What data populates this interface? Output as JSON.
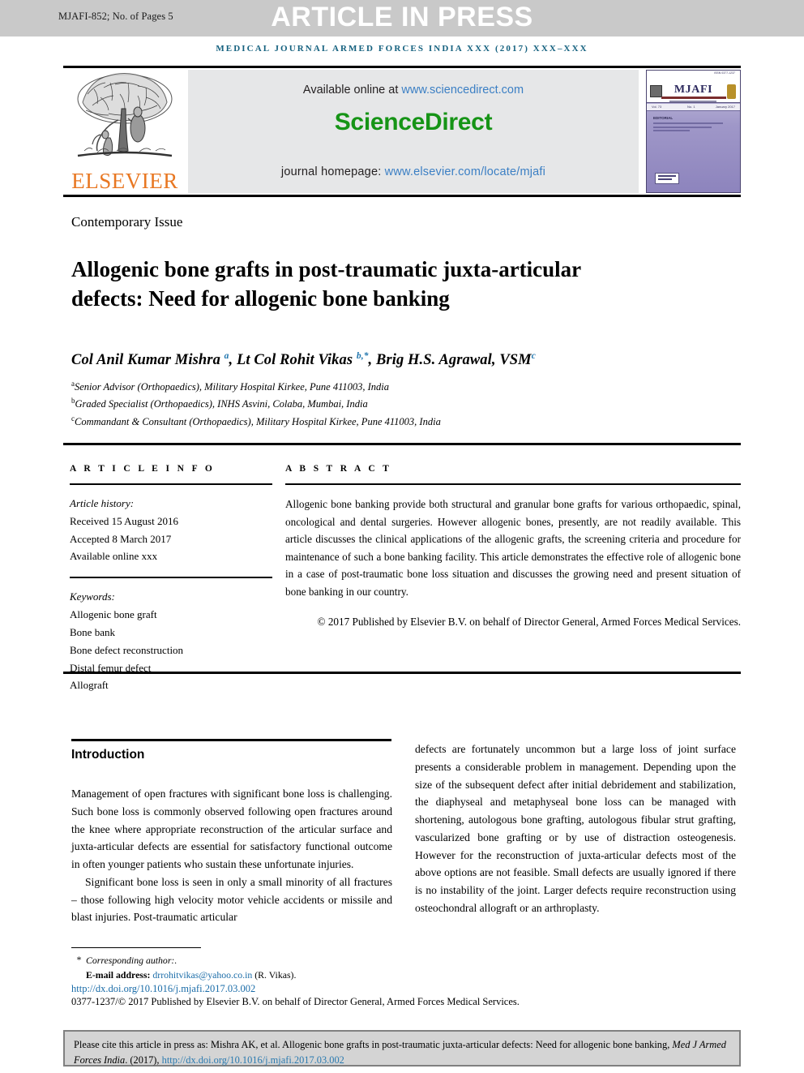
{
  "banner": {
    "article_id": "MJAFI-852; No. of Pages 5",
    "status": "ARTICLE IN PRESS"
  },
  "running_head": "MEDICAL JOURNAL ARMED FORCES INDIA XXX (2017) XXX–XXX",
  "masthead": {
    "publisher": "ELSEVIER",
    "available_prefix": "Available online at ",
    "available_link": "www.sciencedirect.com",
    "sciencedirect_logo": "ScienceDirect",
    "homepage_prefix": "journal homepage: ",
    "homepage_link": "www.elsevier.com/locate/mjafi",
    "cover": {
      "title": "MJAFI",
      "subtitle": "MEDICAL JOURNAL ARMED FORCES INDIA",
      "vol_label": "Vol. 73",
      "issue_label": "No. 1",
      "year_label": "January 2017",
      "issn": "ISSN 0377-1237",
      "article_heading": "EDITORIAL",
      "colors": {
        "cover_top": "#c9c4e0",
        "cover_bottom": "#8d84bd"
      }
    }
  },
  "article": {
    "section_label": "Contemporary Issue",
    "title": "Allogenic bone grafts in post-traumatic juxta-articular defects: Need for allogenic bone banking",
    "authors_html": "Col Anil Kumar Mishra <sup>a</sup>, Lt Col Rohit Vikas <sup>b,</sup><sup>*</sup>, Brig H.S. Agrawal, VSM<sup>c</sup>",
    "affiliations": [
      {
        "marker": "a",
        "text": "Senior Advisor (Orthopaedics), Military Hospital Kirkee, Pune 411003, India"
      },
      {
        "marker": "b",
        "text": "Graded Specialist (Orthopaedics), INHS Asvini, Colaba, Mumbai, India"
      },
      {
        "marker": "c",
        "text": "Commandant & Consultant (Orthopaedics), Military Hospital Kirkee, Pune 411003, India"
      }
    ]
  },
  "article_info": {
    "label": "A R T I C L E   I N F O",
    "history_label": "Article history:",
    "received": "Received 15 August 2016",
    "accepted": "Accepted 8 March 2017",
    "available": "Available online xxx",
    "keywords_label": "Keywords:",
    "keywords": [
      "Allogenic bone graft",
      "Bone bank",
      "Bone defect reconstruction",
      "Distal femur defect",
      "Allograft"
    ]
  },
  "abstract": {
    "label": "A B S T R A C T",
    "text": "Allogenic bone banking provide both structural and granular bone grafts for various orthopaedic, spinal, oncological and dental surgeries. However allogenic bones, presently, are not readily available. This article discusses the clinical applications of the allogenic grafts, the screening criteria and procedure for maintenance of such a bone banking facility. This article demonstrates the effective role of allogenic bone in a case of post-traumatic bone loss situation and discusses the growing need and present situation of bone banking in our country.",
    "copyright": "© 2017 Published by Elsevier B.V. on behalf of Director General, Armed Forces Medical Services."
  },
  "body": {
    "intro_heading": "Introduction",
    "left_paragraphs": [
      "Management of open fractures with significant bone loss is challenging. Such bone loss is commonly observed following open fractures around the knee where appropriate reconstruction of the articular surface and juxta-articular defects are essential for satisfactory functional outcome in often younger patients who sustain these unfortunate injuries.",
      "Significant bone loss is seen in only a small minority of all fractures – those following high velocity motor vehicle accidents or missile and blast injuries. Post-traumatic articular"
    ],
    "right_paragraphs": [
      "defects are fortunately uncommon but a large loss of joint surface presents a considerable problem in management. Depending upon the size of the subsequent defect after initial debridement and stabilization, the diaphyseal and metaphyseal bone loss can be managed with shortening, autologous bone grafting, autologous fibular strut grafting, vascularized bone grafting or by use of distraction osteogenesis. However for the reconstruction of juxta-articular defects most of the above options are not feasible. Small defects are usually ignored if there is no instability of the joint. Larger defects require reconstruction using osteochondral allograft or an arthroplasty."
    ]
  },
  "footer": {
    "corresponding_author": "Corresponding author:.",
    "email_label": "E-mail address:",
    "email": "drrohitvikas@yahoo.co.in",
    "email_suffix": "(R. Vikas).",
    "doi": "http://dx.doi.org/10.1016/j.mjafi.2017.03.002",
    "issn_line": "0377-1237/© 2017 Published by Elsevier B.V. on behalf of Director General, Armed Forces Medical Services."
  },
  "cite_box": {
    "prefix": "Please cite this article in press as: Mishra AK, et al. Allogenic bone grafts in post-traumatic juxta-articular defects: Need for allogenic bone banking, ",
    "journal": "Med J Armed Forces India",
    "middle": ". (2017), ",
    "doi": "http://dx.doi.org/10.1016/j.mjafi.2017.03.002"
  },
  "colors": {
    "banner_gray": "#c9c9c9",
    "running_head_blue": "#15617f",
    "sciencedirect_green": "#169416",
    "elsevier_orange": "#e87722",
    "link_blue": "#3b7fc4",
    "superscript_blue": "#2176ae"
  }
}
